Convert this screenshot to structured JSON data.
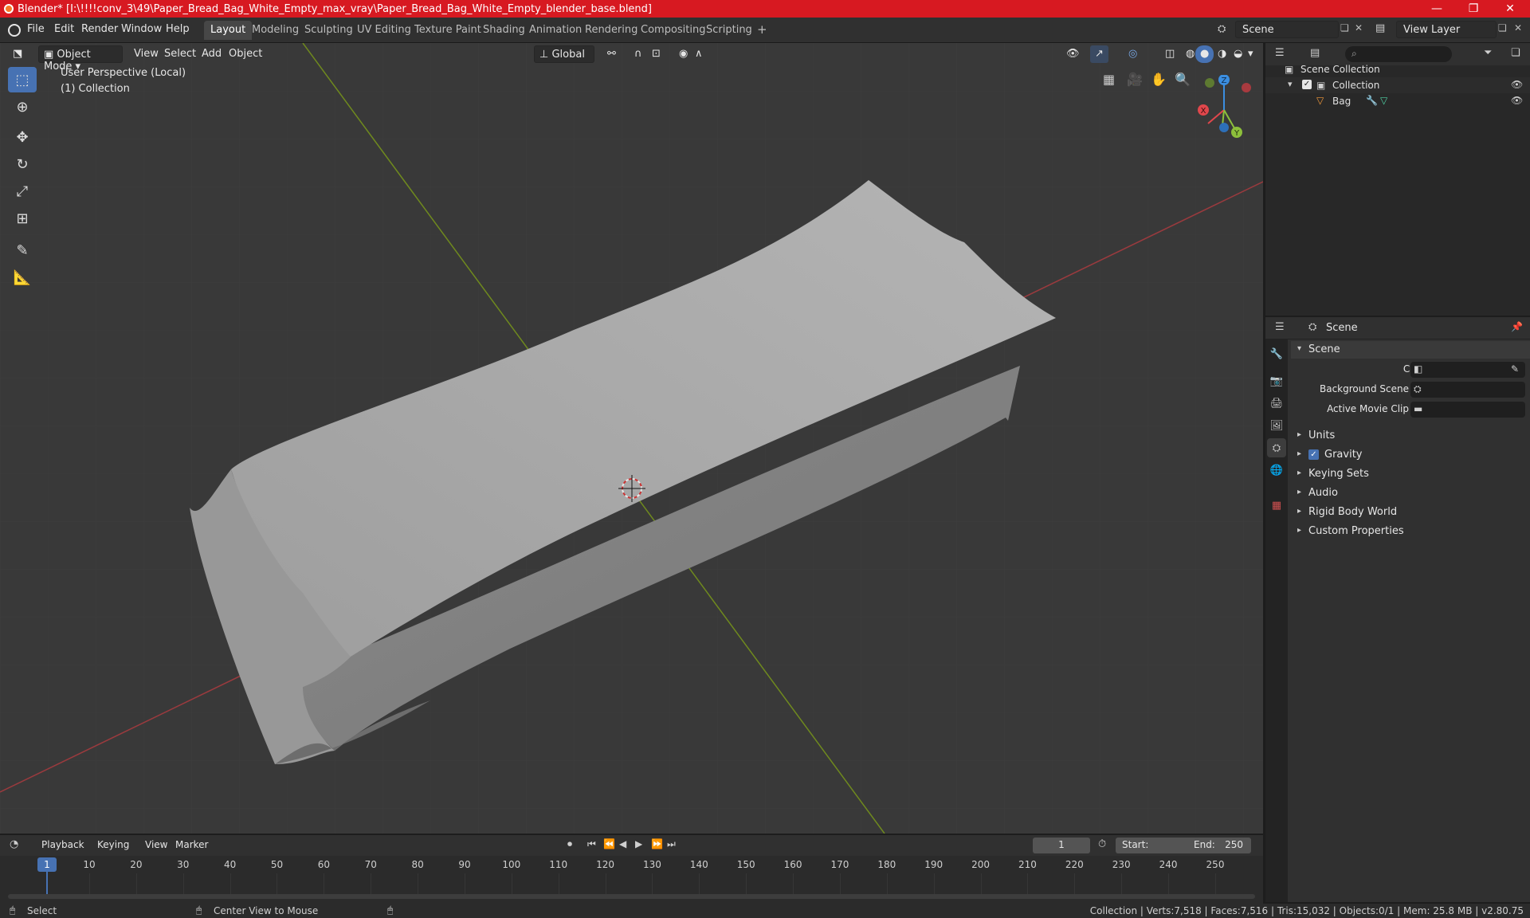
{
  "window": {
    "title": "Blender* [I:\\!!!!conv_3\\49\\Paper_Bread_Bag_White_Empty_max_vray\\Paper_Bread_Bag_White_Empty_blender_base.blend]",
    "minimize": "—",
    "maximize": "❐",
    "close": "✕"
  },
  "menu": {
    "file": "File",
    "edit": "Edit",
    "render": "Render",
    "window": "Window",
    "help": "Help"
  },
  "workspaces": [
    "Layout",
    "Modeling",
    "Sculpting",
    "UV Editing",
    "Texture Paint",
    "Shading",
    "Animation",
    "Rendering",
    "Compositing",
    "Scripting",
    "+"
  ],
  "scene_selector": {
    "value": "Scene"
  },
  "view_layer_selector": {
    "value": "View Layer"
  },
  "viewport_header": {
    "mode": "Object Mode",
    "view": "View",
    "select": "Select",
    "add": "Add",
    "object": "Object",
    "transform_orientation": "Global"
  },
  "viewport": {
    "perspective_label": "User Perspective (Local)",
    "collection_label": "(1) Collection",
    "gizmo": {
      "x": "X",
      "y": "Y",
      "z": "Z"
    }
  },
  "outliner": {
    "search_placeholder": "",
    "items": [
      {
        "label": "Scene Collection"
      },
      {
        "label": "Collection"
      },
      {
        "label": "Bag"
      }
    ]
  },
  "properties": {
    "header_label": "Scene",
    "panel_title": "Scene",
    "fields": [
      {
        "label": "Camera",
        "value": ""
      },
      {
        "label": "Background Scene",
        "value": ""
      },
      {
        "label": "Active Movie Clip",
        "value": ""
      }
    ],
    "sections": [
      {
        "label": "Units",
        "checkbox": false
      },
      {
        "label": "Gravity",
        "checkbox": true
      },
      {
        "label": "Keying Sets",
        "checkbox": false
      },
      {
        "label": "Audio",
        "checkbox": false
      },
      {
        "label": "Rigid Body World",
        "checkbox": false
      },
      {
        "label": "Custom Properties",
        "checkbox": false
      }
    ]
  },
  "timeline": {
    "playback": "Playback",
    "keying": "Keying",
    "view": "View",
    "marker": "Marker",
    "current_frame": "1",
    "start_label": "Start:",
    "start_value": "1",
    "end_label": "End:",
    "end_value": "250",
    "ticks": [
      "1",
      "10",
      "20",
      "30",
      "40",
      "50",
      "60",
      "70",
      "80",
      "90",
      "100",
      "110",
      "120",
      "130",
      "140",
      "150",
      "160",
      "170",
      "180",
      "190",
      "200",
      "210",
      "220",
      "230",
      "240",
      "250"
    ]
  },
  "statusbar": {
    "select": "Select",
    "center_view": "Center View to Mouse",
    "stats": "Collection | Verts:7,518 | Faces:7,516 | Tris:15,032 | Objects:0/1 | Mem: 25.8 MB | v2.80.75"
  },
  "colors": {
    "accent": "#4772b3",
    "titlebar": "#d71921",
    "x_axis": "#e0474c",
    "y_axis": "#8dc03b",
    "z_axis": "#3b8ee0"
  }
}
